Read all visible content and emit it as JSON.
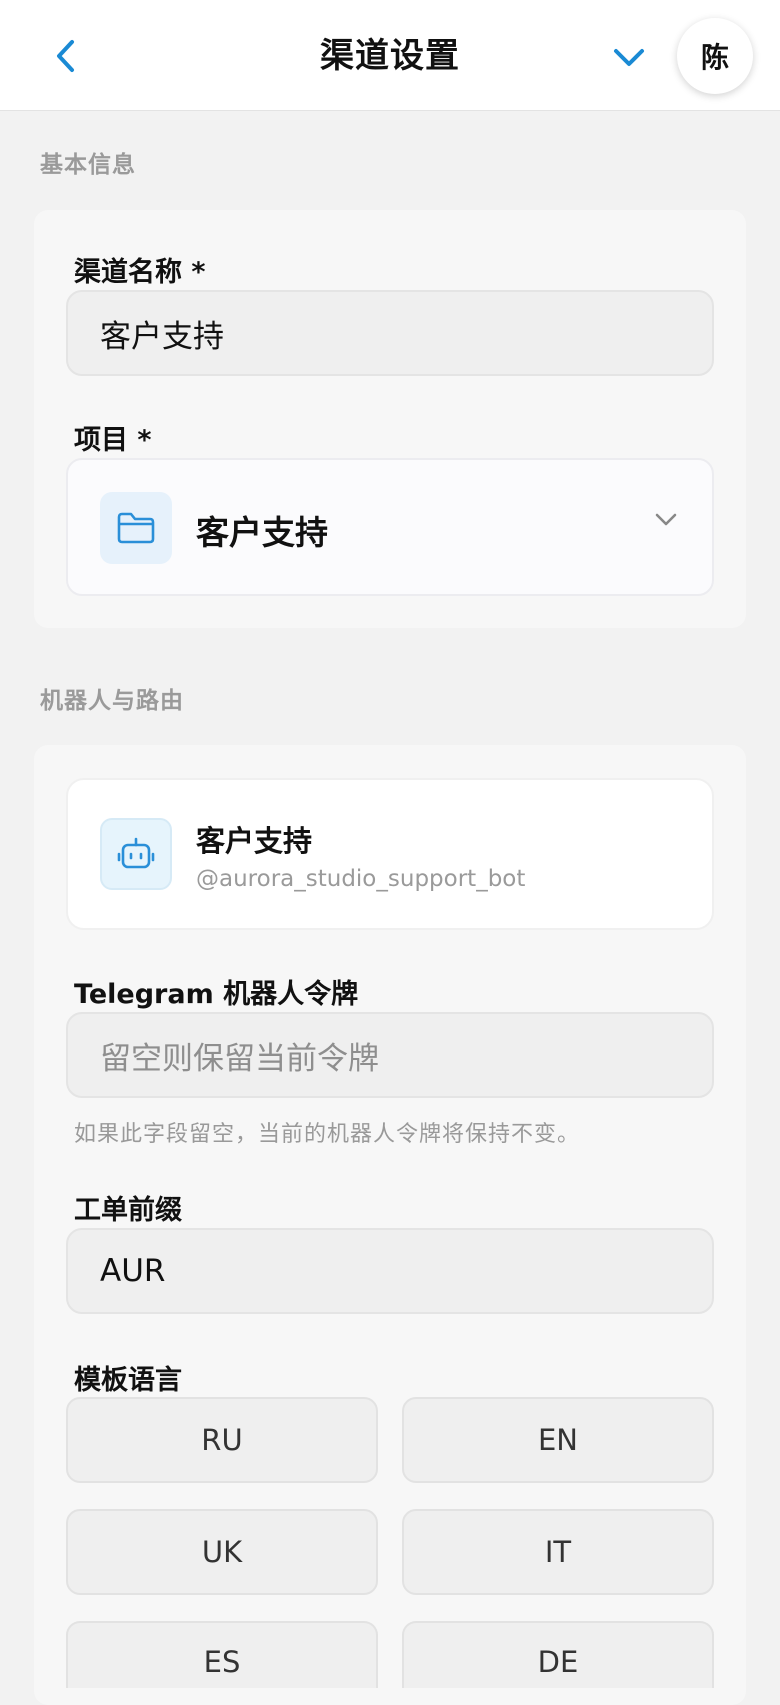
{
  "header": {
    "title": "渠道设置",
    "avatar_initial": "陈"
  },
  "basic_info": {
    "section_label": "基本信息",
    "channel_name_label": "渠道名称 *",
    "channel_name_value": "客户支持",
    "project_label": "项目 *",
    "project_value": "客户支持"
  },
  "bot_routing": {
    "section_label": "机器人与路由",
    "bot_name": "客户支持",
    "bot_handle": "@aurora_studio_support_bot",
    "token_label": "Telegram 机器人令牌",
    "token_placeholder": "留空则保留当前令牌",
    "token_hint": "如果此字段留空，当前的机器人令牌将保持不变。",
    "ticket_prefix_label": "工单前缀",
    "ticket_prefix_value": "AUR",
    "template_language_label": "模板语言",
    "languages": [
      "RU",
      "EN",
      "UK",
      "IT",
      "ES",
      "DE"
    ]
  },
  "colors": {
    "accent": "#1a8ad4",
    "background": "#f2f2f2"
  },
  "icons": {
    "back": "chevron-left-icon",
    "collapse": "chevron-down-icon",
    "folder": "folder-icon",
    "bot": "robot-icon",
    "select_chevron": "chevron-down-icon"
  }
}
